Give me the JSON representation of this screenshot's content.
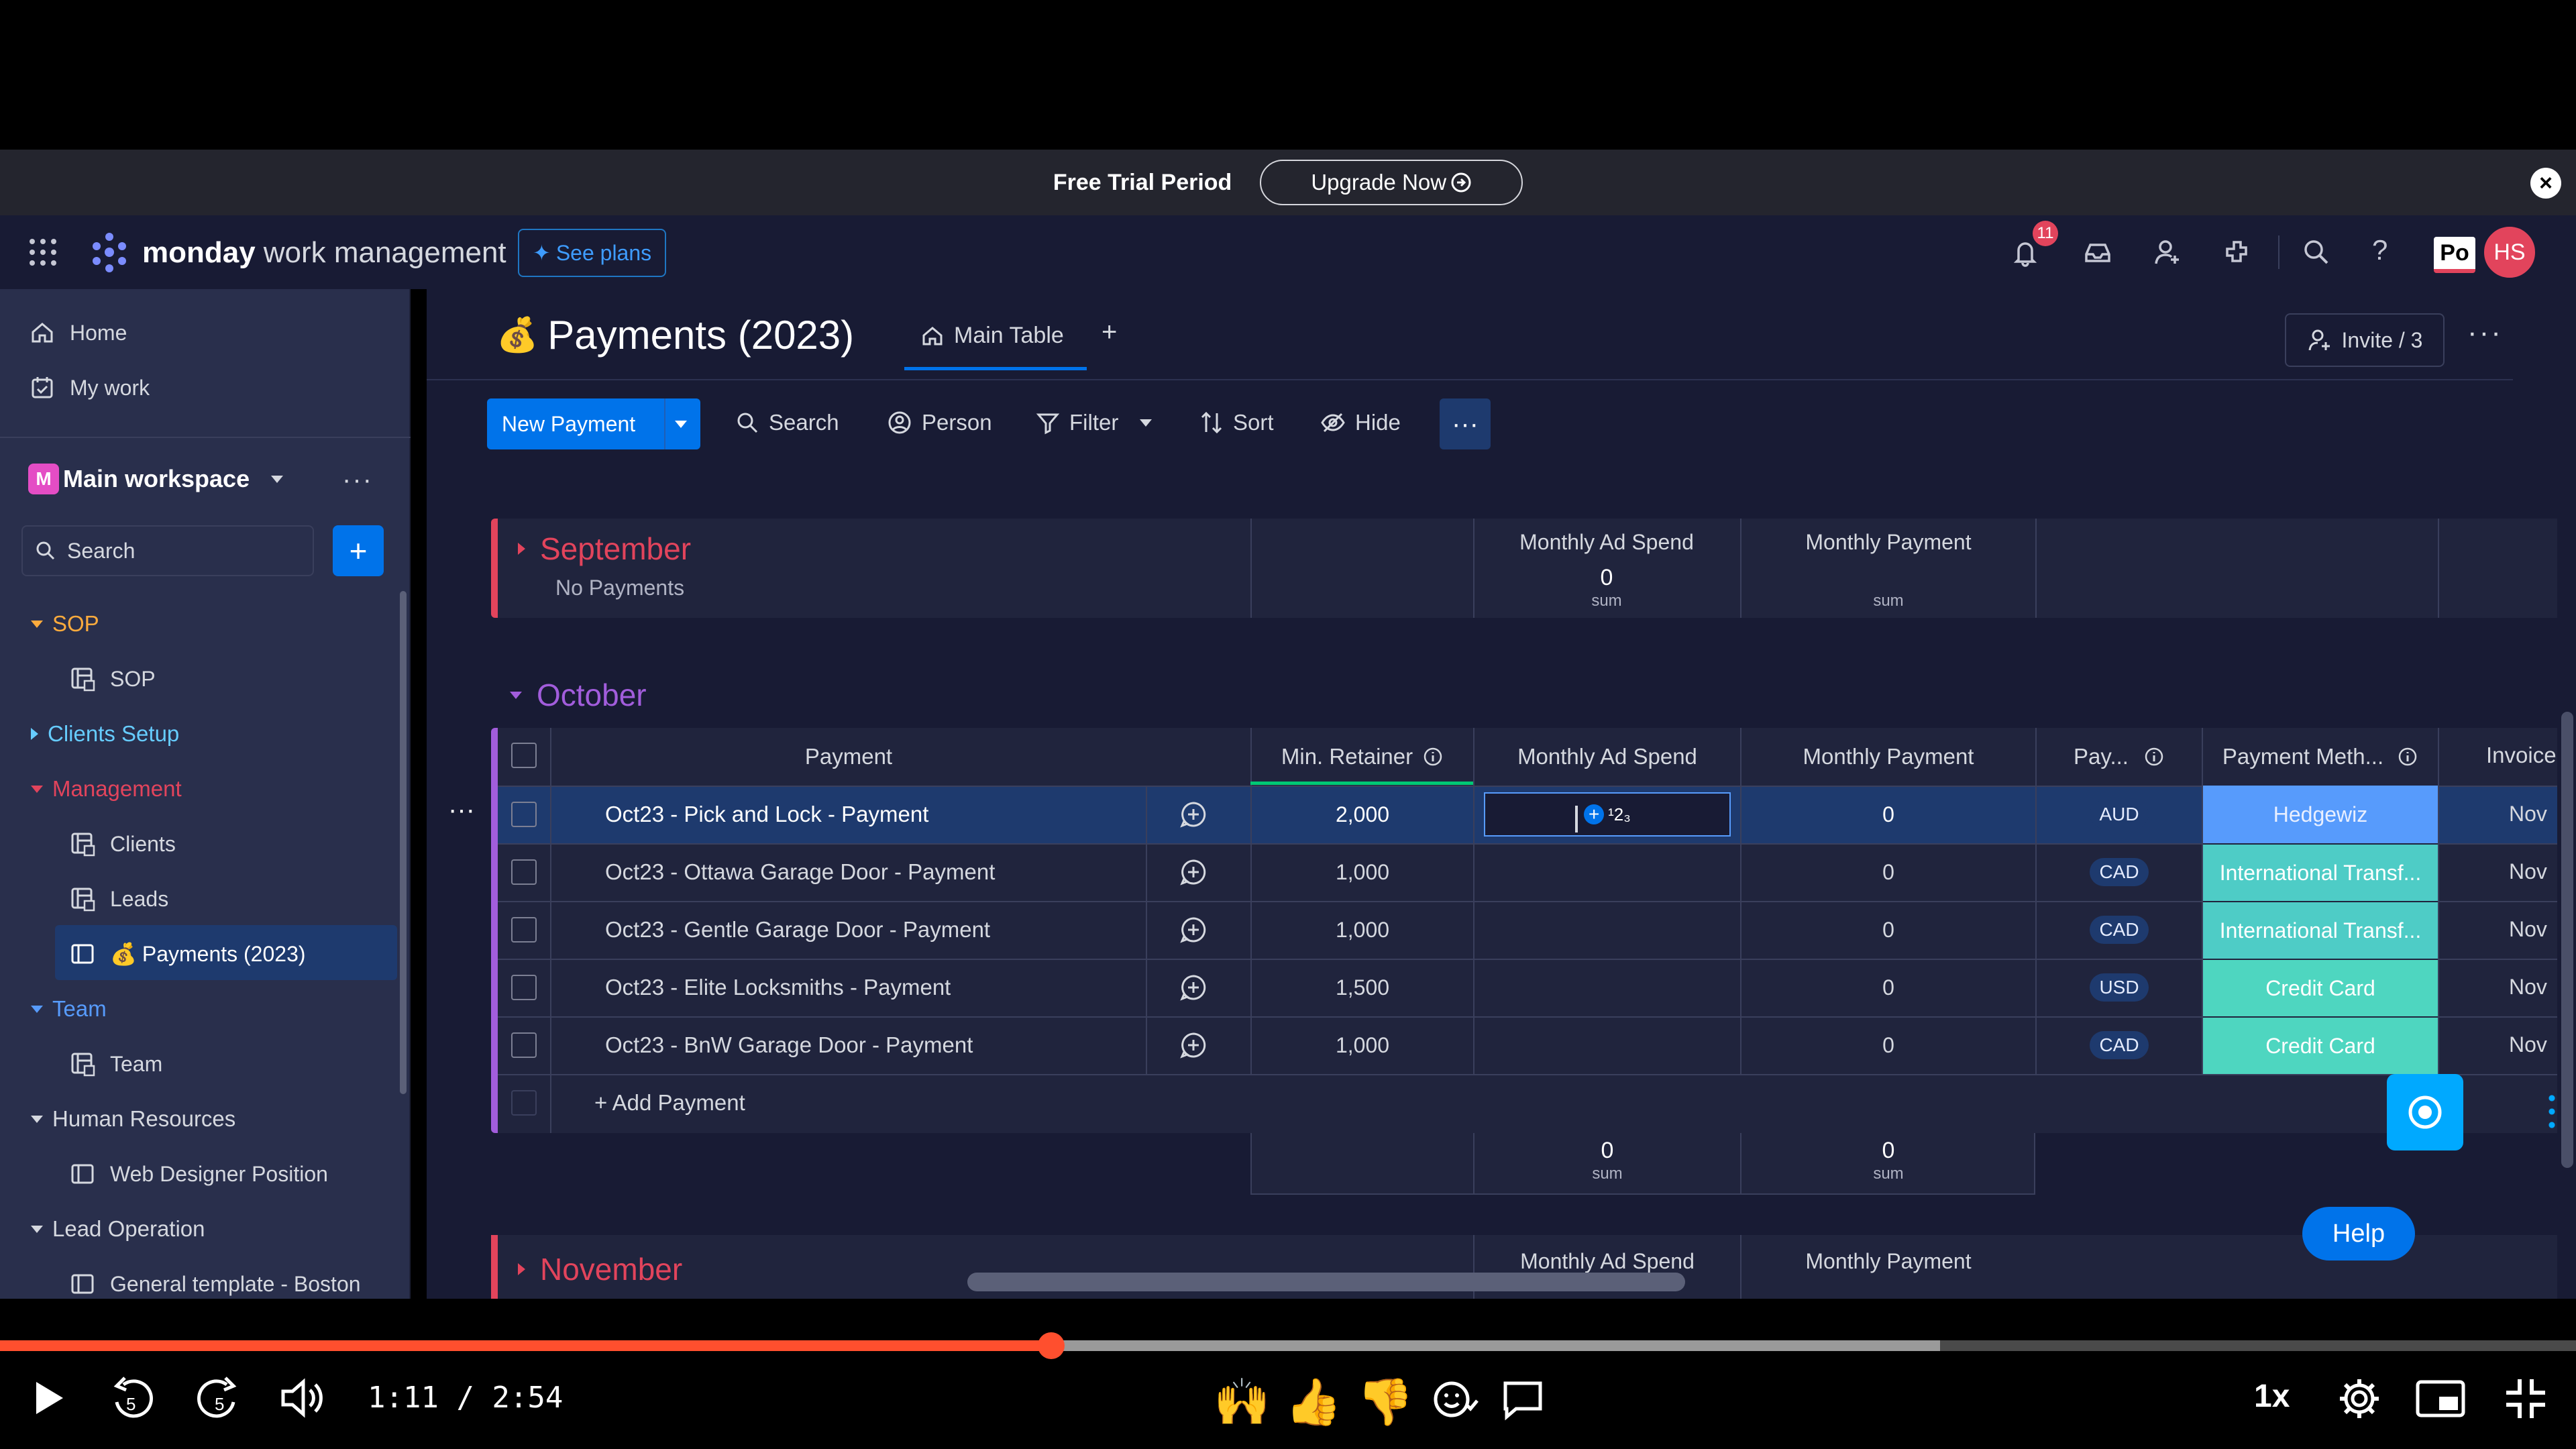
{
  "banner": {
    "text": "Free Trial Period",
    "upgrade": "Upgrade Now"
  },
  "topbar": {
    "brand_bold": "monday",
    "brand_rest": "work management",
    "see_plans": "See plans",
    "notifications_count": "11",
    "avatar_initials": "HS",
    "po_label": "Po"
  },
  "sidebar": {
    "home": "Home",
    "my_work": "My work",
    "workspace": "Main workspace",
    "workspace_initial": "M",
    "search_placeholder": "Search",
    "items": [
      {
        "label": "SOP",
        "type": "group",
        "color": "#fdab3d",
        "expanded": true
      },
      {
        "label": "SOP",
        "type": "board"
      },
      {
        "label": "Clients Setup",
        "type": "group",
        "color": "#66ccff",
        "expanded": false
      },
      {
        "label": "Management",
        "type": "group",
        "color": "#e2445c",
        "expanded": true
      },
      {
        "label": "Clients",
        "type": "board"
      },
      {
        "label": "Leads",
        "type": "board"
      },
      {
        "label": "Payments (2023)",
        "type": "board",
        "active": true
      },
      {
        "label": "Team",
        "type": "group",
        "color": "#579bfc",
        "expanded": true
      },
      {
        "label": "Team",
        "type": "board"
      },
      {
        "label": "Human Resources",
        "type": "group",
        "color": "#d5d8df",
        "expanded": true
      },
      {
        "label": "Web Designer Position",
        "type": "doc"
      },
      {
        "label": "Lead Operation",
        "type": "group",
        "color": "#d5d8df",
        "expanded": true
      },
      {
        "label": "General template - Boston",
        "type": "doc"
      }
    ]
  },
  "board": {
    "title": "Payments (2023)",
    "tab_main": "Main Table",
    "invite": "Invite / 3",
    "toolbar": {
      "new_item": "New Payment",
      "search": "Search",
      "person": "Person",
      "filter": "Filter",
      "sort": "Sort",
      "hide": "Hide"
    }
  },
  "september": {
    "name": "September",
    "subtitle": "No Payments",
    "col_ad": "Monthly Ad Spend",
    "col_pay": "Monthly Payment",
    "ad_sum": "0",
    "ad_sum_label": "sum",
    "pay_sum_label": "sum"
  },
  "october": {
    "name": "October",
    "columns": {
      "payment": "Payment",
      "retainer": "Min. Retainer",
      "ad": "Monthly Ad Spend",
      "monthly": "Monthly Payment",
      "pay": "Pay...",
      "method": "Payment Meth...",
      "invoice": "Invoice"
    },
    "rows": [
      {
        "name": "Oct23 - Pick and Lock - Payment",
        "retainer": "2,000",
        "monthly": "0",
        "currency": "AUD",
        "method": "Hedgewiz",
        "invoice": "Nov"
      },
      {
        "name": "Oct23 - Ottawa Garage Door - Payment",
        "retainer": "1,000",
        "monthly": "0",
        "currency": "CAD",
        "method": "International Transf...",
        "invoice": "Nov"
      },
      {
        "name": "Oct23 - Gentle Garage Door - Payment",
        "retainer": "1,000",
        "monthly": "0",
        "currency": "CAD",
        "method": "International Transf...",
        "invoice": "Nov"
      },
      {
        "name": "Oct23 - Elite Locksmiths - Payment",
        "retainer": "1,500",
        "monthly": "0",
        "currency": "USD",
        "method": "Credit Card",
        "invoice": "Nov"
      },
      {
        "name": "Oct23 - BnW Garage Door - Payment",
        "retainer": "1,000",
        "monthly": "0",
        "currency": "CAD",
        "method": "Credit Card",
        "invoice": "Nov"
      }
    ],
    "add_item": "+ Add Payment",
    "editing_value": "¹2₃",
    "sum_ad": "0",
    "sum_ad_label": "sum",
    "sum_pay": "0",
    "sum_pay_label": "sum"
  },
  "november": {
    "name": "November",
    "col_ad": "Monthly Ad Spend",
    "col_pay": "Monthly Payment"
  },
  "help": "Help",
  "player": {
    "time": "1:11 / 2:54",
    "speed": "1x",
    "played_fraction": 0.408,
    "buffered_fraction": 0.753,
    "emojis": [
      "😂",
      "😍",
      "😮",
      "🙌",
      "👍",
      "👎"
    ]
  }
}
